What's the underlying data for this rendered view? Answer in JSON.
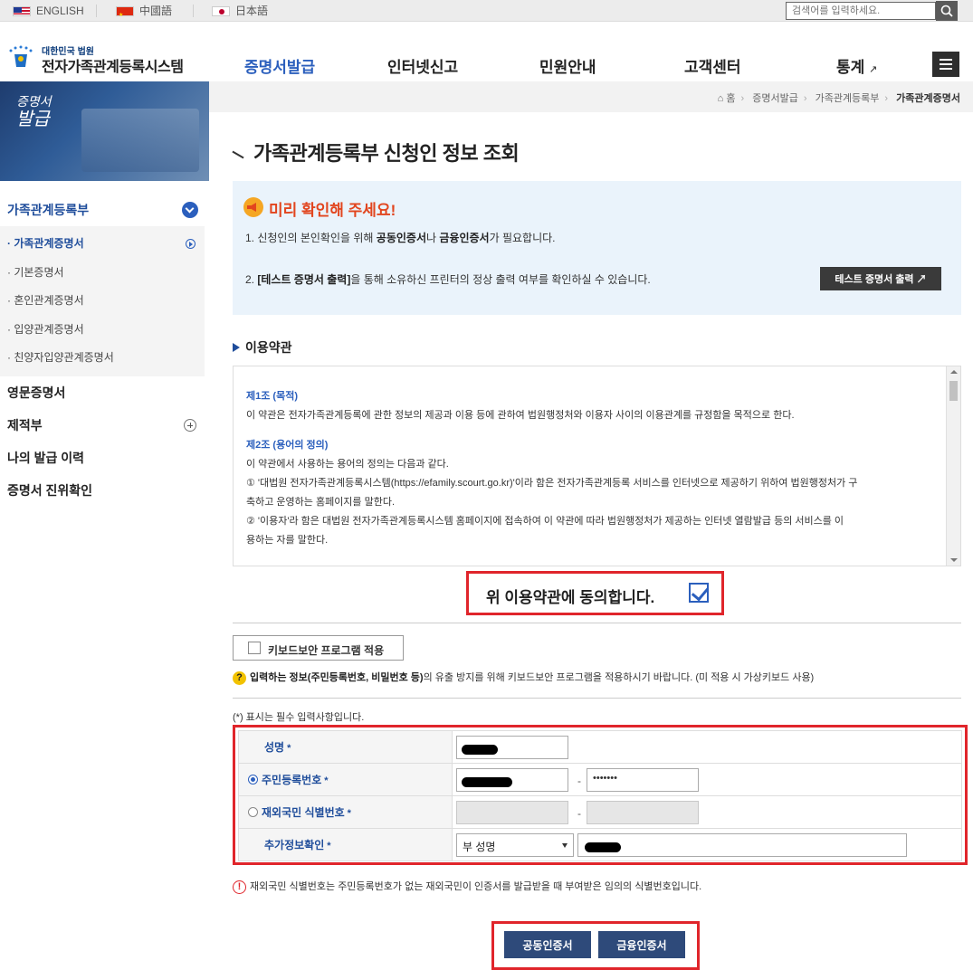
{
  "topbar": {
    "languages": [
      {
        "label": "ENGLISH",
        "icon": "us-flag-icon"
      },
      {
        "label": "中國語",
        "icon": "china-flag-icon"
      },
      {
        "label": "日本語",
        "icon": "japan-flag-icon"
      }
    ],
    "search_placeholder": "검색어를 입력하세요."
  },
  "header": {
    "logo_sub": "대한민국 법원",
    "logo_main": "전자가족관계등록시스템",
    "nav": [
      {
        "label": "증명서발급",
        "active": true
      },
      {
        "label": "인터넷신고"
      },
      {
        "label": "민원안내"
      },
      {
        "label": "고객센터"
      },
      {
        "label": "통계"
      }
    ],
    "external_mark": "↗"
  },
  "sidebar": {
    "banner_small": "증명서",
    "banner_big": "발급",
    "groups": [
      {
        "label": "가족관계등록부"
      },
      {
        "label": "영문증명서"
      },
      {
        "label": "제적부"
      },
      {
        "label": "나의 발급 이력"
      },
      {
        "label": "증명서 진위확인"
      }
    ],
    "sub_items": [
      {
        "label": "· 가족관계증명서",
        "active": true
      },
      {
        "label": "· 기본증명서"
      },
      {
        "label": "· 혼인관계증명서"
      },
      {
        "label": "· 입양관계증명서"
      },
      {
        "label": "· 친양자입양관계증명서"
      }
    ]
  },
  "breadcrumb": {
    "home": "홈",
    "items": [
      "증명서발급",
      "가족관계등록부",
      "가족관계증명서"
    ]
  },
  "main": {
    "title": "가족관계등록부 신청인 정보 조회",
    "notice": {
      "title": "미리 확인해 주세요!",
      "line1_a": "1. 신청인의 본인확인을 위해 ",
      "line1_b": "공동인증서",
      "line1_c": "나 ",
      "line1_d": "금융인증서",
      "line1_e": "가 필요합니다.",
      "line2_a": "2. ",
      "line2_b": "[테스트 증명서 출력]",
      "line2_c": "을 통해 소유하신 프린터의 정상 출력 여부를 확인하실 수 있습니다.",
      "test_button": "테스트 증명서 출력"
    },
    "terms": {
      "heading": "이용약관",
      "articles": [
        {
          "title": "제1조 (목적)",
          "lines": [
            "이 약관은 전자가족관계등록에 관한 정보의 제공과 이용 등에 관하여 법원행정처와 이용자 사이의 이용관계를 규정함을 목적으로 한다."
          ]
        },
        {
          "title": "제2조 (용어의 정의)",
          "lines": [
            "이 약관에서 사용하는 용어의 정의는 다음과 같다.",
            "① '대법원 전자가족관계등록시스템(https://efamily.scourt.go.kr)'이라 함은 전자가족관계등록 서비스를 인터넷으로 제공하기 위하여 법원행정처가 구",
            "축하고 운영하는 홈페이지를 말한다.",
            "② '이용자'라 함은 대법원 전자가족관계등록시스템 홈페이지에 접속하여 이 약관에 따라 법원행정처가 제공하는 인터넷 열람발급 등의 서비스를 이",
            "용하는 자를 말한다."
          ]
        }
      ],
      "agree_label": "위 이용약관에 동의합니다.",
      "agree_checked": true
    },
    "keyboard": {
      "button": "키보드보안 프로그램 적용",
      "note_a": "입력하는 정보",
      "note_b": "(주민등록번호, 비밀번호 등)",
      "note_c": "의 유출 방지를 위해 키보드보안 프로그램을 적용하시기 바랍니다. (미 적용 시 가상키보드 사용)"
    },
    "required_note": "(*) 표시는 필수 입력사항입니다.",
    "form": {
      "rows": [
        {
          "label": "성명"
        },
        {
          "label": "주민등록번호",
          "selected": true
        },
        {
          "label": "재외국민 식별번호",
          "selected": false
        },
        {
          "label": "추가정보확인"
        }
      ],
      "star": "*",
      "dash": "-",
      "rrn_back_value": "•••••••",
      "add_info_select": "부 성명"
    },
    "foreign_note": "재외국민 식별번호는 주민등록번호가 없는 재외국민이 인증서를 발급받을 때 부여받은 임의의 식별번호입니다.",
    "cert_buttons": [
      "공동인증서",
      "금융인증서"
    ]
  },
  "colors": {
    "brand_blue": "#2b5fbd",
    "highlight_red": "#e0252b",
    "notice_orange": "#e2451e"
  }
}
